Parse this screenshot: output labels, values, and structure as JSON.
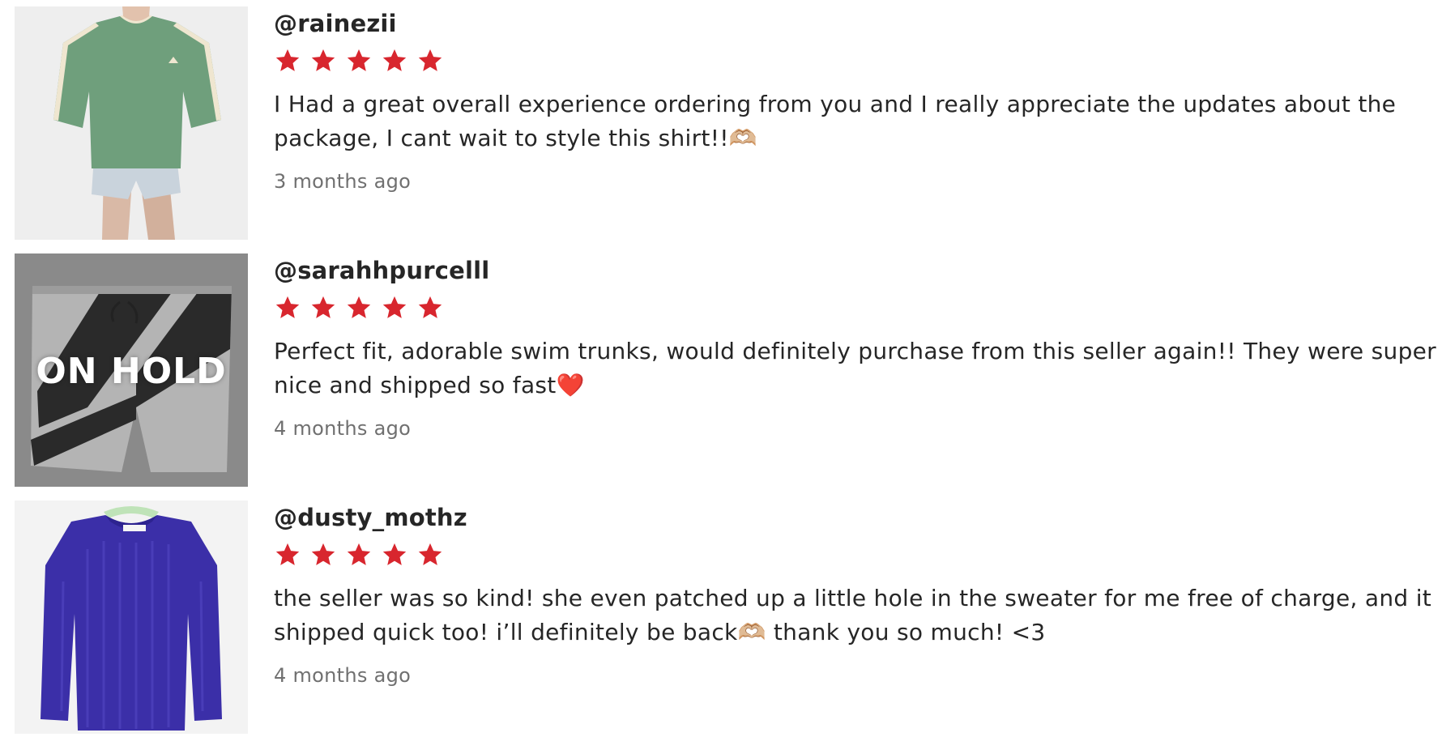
{
  "reviews": [
    {
      "username": "@rainezii",
      "rating": 5,
      "max_rating": 5,
      "comment": "I Had a great overall experience ordering from you and I really appreciate the updates about the package, I cant wait to style this shirt!!🫶🏼",
      "time_ago": "3 months ago",
      "item_icon": "green-tshirt-photo",
      "overlay": ""
    },
    {
      "username": "@sarahhpurcelll",
      "rating": 5,
      "max_rating": 5,
      "comment": "Perfect fit, adorable swim trunks, would definitely purchase from this seller again!! They were super nice and shipped so fast❤️",
      "time_ago": "4 months ago",
      "item_icon": "swim-trunks-photo",
      "overlay": "ON HOLD"
    },
    {
      "username": "@dusty_mothz",
      "rating": 5,
      "max_rating": 5,
      "comment": "the seller was so kind! she even patched up a little hole in the sweater for me free of charge, and it shipped quick too! i’ll definitely be back🫶🏼 thank you so much! <3",
      "time_ago": "4 months ago",
      "item_icon": "blue-sweater-photo",
      "overlay": ""
    }
  ],
  "colors": {
    "star": "#d8262e",
    "text": "#262626",
    "muted": "#707070"
  }
}
